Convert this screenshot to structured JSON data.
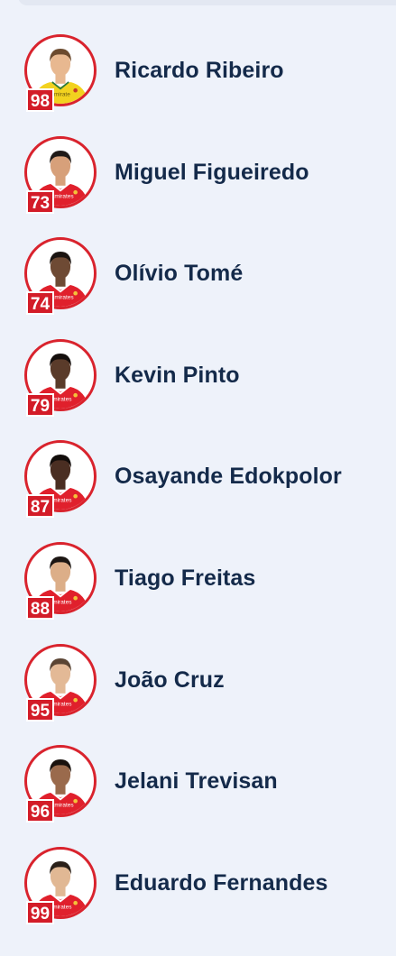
{
  "players": [
    {
      "name": "Ricardo Ribeiro",
      "number": "98",
      "kit": "goalkeeper",
      "kit_color": "#f2d21f",
      "skin": "#e8b890",
      "hair": "#6b4a2e",
      "sponsor": "mirate"
    },
    {
      "name": "Miguel Figueiredo",
      "number": "73",
      "kit": "outfield",
      "kit_color": "#e0202c",
      "skin": "#d7a07a",
      "hair": "#1f1a18",
      "sponsor": "Emirates"
    },
    {
      "name": "Olívio Tomé",
      "number": "74",
      "kit": "outfield",
      "kit_color": "#e0202c",
      "skin": "#6e4a34",
      "hair": "#1a1411",
      "sponsor": "Emirates"
    },
    {
      "name": "Kevin Pinto",
      "number": "79",
      "kit": "outfield",
      "kit_color": "#e0202c",
      "skin": "#5a3b2a",
      "hair": "#140f0d",
      "sponsor": "mirates"
    },
    {
      "name": "Osayande Edokpolor",
      "number": "87",
      "kit": "outfield",
      "kit_color": "#e0202c",
      "skin": "#4a2e22",
      "hair": "#120d0b",
      "sponsor": "mirates"
    },
    {
      "name": "Tiago Freitas",
      "number": "88",
      "kit": "outfield",
      "kit_color": "#e0202c",
      "skin": "#dcae88",
      "hair": "#1c1613",
      "sponsor": "mirates"
    },
    {
      "name": "João Cruz",
      "number": "95",
      "kit": "outfield",
      "kit_color": "#e0202c",
      "skin": "#e3b996",
      "hair": "#5a4433",
      "sponsor": "mirates"
    },
    {
      "name": "Jelani Trevisan",
      "number": "96",
      "kit": "outfield",
      "kit_color": "#e0202c",
      "skin": "#9a6a4c",
      "hair": "#1a120e",
      "sponsor": "Emirates"
    },
    {
      "name": "Eduardo Fernandes",
      "number": "99",
      "kit": "outfield",
      "kit_color": "#e0202c",
      "skin": "#e1b894",
      "hair": "#2a2019",
      "sponsor": "mirates"
    }
  ],
  "accent_color": "#d9232d",
  "name_color": "#142a4a"
}
